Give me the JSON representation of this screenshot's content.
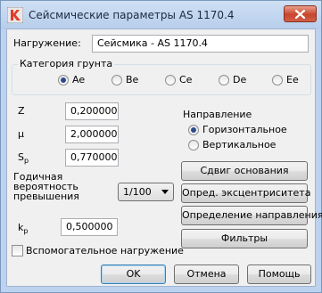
{
  "window": {
    "title": "Сейсмические параметры AS 1170.4"
  },
  "load": {
    "label": "Нагружение:",
    "value": "Сейсмика - AS 1170.4"
  },
  "soil": {
    "group_title": "Категория грунта",
    "options": [
      "Ae",
      "Be",
      "Ce",
      "De",
      "Ee"
    ],
    "selected": "Ae"
  },
  "params": {
    "z_label": "Z",
    "z_value": "0,200000",
    "mu_label": "µ",
    "mu_value": "2,000000",
    "sp_label_main": "S",
    "sp_label_sub": "p",
    "sp_value": "0,770000",
    "prob_label_1": "Годичная",
    "prob_label_2": "вероятность",
    "prob_label_3": "превышения",
    "prob_value": "1/100",
    "kp_label_main": "k",
    "kp_label_sub": "p",
    "kp_value": "0,500000"
  },
  "direction": {
    "group_title": "Направление",
    "horizontal_label": "Горизонтальное",
    "vertical_label": "Вертикальное",
    "selected": "Горизонтальное"
  },
  "buttons": {
    "base_shift": "Сдвиг основания",
    "eccentricity": "Опред. эксцентриситета",
    "direction_def": "Определение направления",
    "filters": "Фильтры",
    "ok": "OK",
    "cancel": "Отмена",
    "help": "Помощь"
  },
  "auxiliary": {
    "label": "Вспомогательное нагружение",
    "checked": false
  },
  "colors": {
    "titlebar": "#bcd2ee",
    "dialog_bg": "#f0f0f0",
    "close_button": "#c9452c",
    "radio_dot": "#2a4a8a"
  },
  "icons": {
    "app": "app-logo-icon",
    "close": "close-icon",
    "dropdown": "chevron-down-icon"
  }
}
